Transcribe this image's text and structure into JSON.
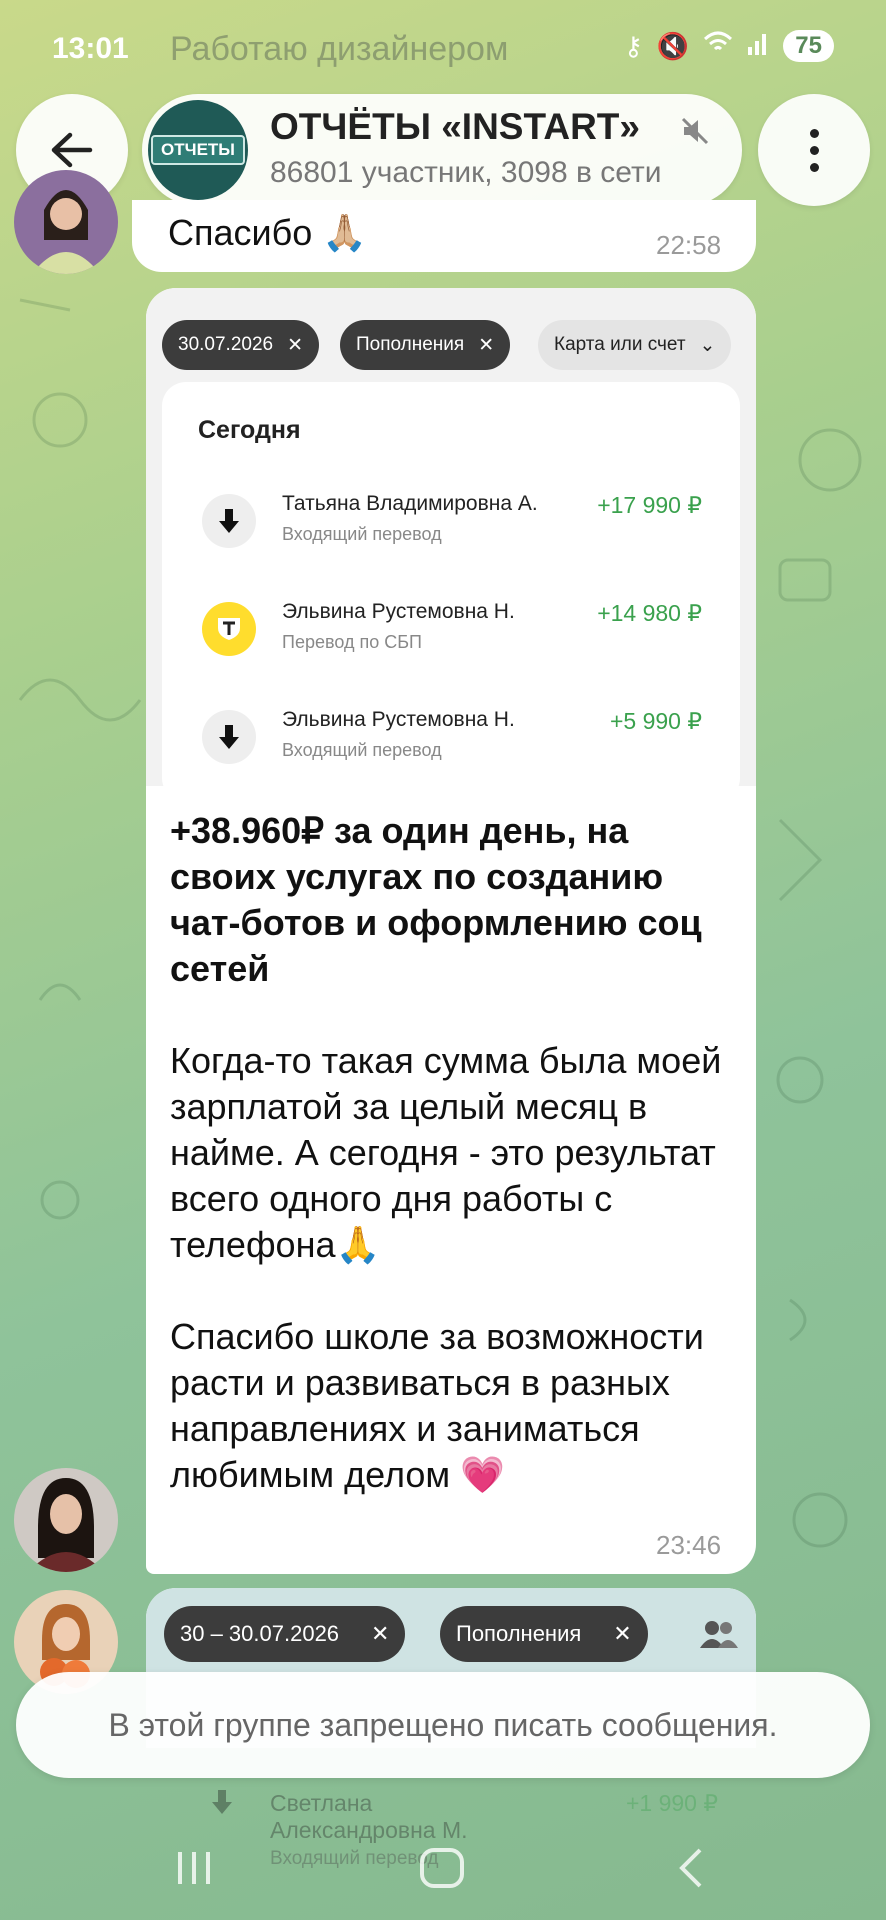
{
  "status_bar": {
    "time": "13:01",
    "background_text": "Работаю дизайнером",
    "battery": "75"
  },
  "header": {
    "title": "ОТЧЁТЫ «INSTART»",
    "subtitle": "86801 участник, 3098 в сети",
    "avatar_text": "ОТЧЕТЫ"
  },
  "messages": [
    {
      "text": "Спасибо 🙏🏼",
      "time": "22:58"
    },
    {
      "screenshot": {
        "chips": [
          "30.07.2026",
          "Пополнения",
          "Карта или счет"
        ],
        "heading": "Сегодня",
        "transactions": [
          {
            "name": "Татьяна Владимировна А.",
            "type": "Входящий перевод",
            "amount": "+17 990 ₽",
            "icon": "arrow-down-icon"
          },
          {
            "name": "Эльвина Рустемовна Н.",
            "type": "Перевод по СБП",
            "amount": "+14 980 ₽",
            "icon": "tbank-icon"
          },
          {
            "name": "Эльвина Рустемовна Н.",
            "type": "Входящий перевод",
            "amount": "+5 990 ₽",
            "icon": "arrow-down-icon"
          }
        ]
      },
      "headline": "+38.960₽ за один день, на своих услугах по созданию чат-ботов и оформлению соц сетей",
      "paragraph1": "Когда-то такая сумма была моей зарплатой за целый месяц в найме. А сегодня - это результат всего одного дня работы с телефона🙏",
      "paragraph2": "Спасибо школе за возможности расти и развиваться в разных направлениях и заниматься любимым делом 💗",
      "time": "23:46"
    },
    {
      "screenshot": {
        "chips": [
          "30 – 30.07.2026",
          "Пополнения"
        ],
        "transaction": {
          "name_line1": "Светлана",
          "name_line2": "Александровна М.",
          "type": "Входящий перевод",
          "amount": "+1 990 ₽"
        }
      }
    }
  ],
  "compose": {
    "disabled_text": "В этой группе запрещено писать сообщения."
  },
  "colors": {
    "income_green": "#3aa14d",
    "chip_dark": "#3c3c3c",
    "tbank_yellow": "#ffdd2d"
  }
}
